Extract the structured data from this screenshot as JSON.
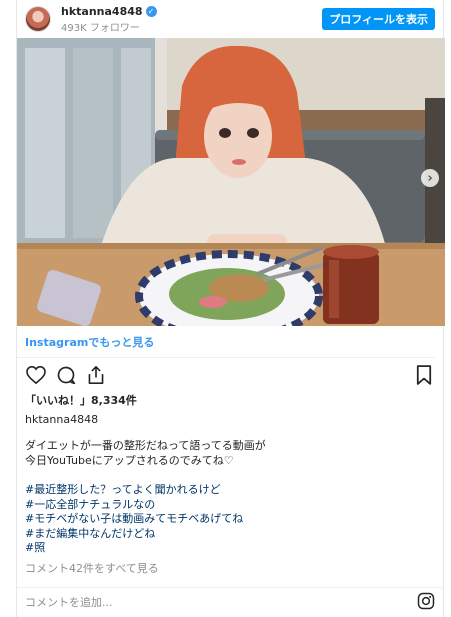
{
  "header": {
    "username": "hktanna4848",
    "followers": "493K フォロワー",
    "profile_button": "プロフィールを表示"
  },
  "icons": {
    "verified": "verified-badge-icon",
    "carousel_next": "chevron-right-icon",
    "like": "heart-icon",
    "comment": "comment-bubble-icon",
    "share": "share-icon",
    "save": "bookmark-icon",
    "brand": "instagram-logo-icon"
  },
  "post": {
    "instagram_link": "Instagramでもっと見る",
    "likes": "「いいね！」8,334件",
    "username": "hktanna4848",
    "caption_lines": [
      "ダイエットが一番の整形だねって語ってる動画が",
      "今日YouTubeにアップされるのでみてね♡"
    ],
    "hashtags": [
      "#最近整形した？ってよく聞かれるけど",
      "#一応全部ナチュラルなの",
      "#モチベがない子は動画みてモチベあげてね",
      "#まだ編集中なんだけどね",
      "#照"
    ],
    "view_comments": "コメント42件をすべて見る",
    "comment_placeholder": "コメントを追加..."
  },
  "colors": {
    "accent": "#0095f6",
    "link": "#3897f0",
    "hashtag": "#003569",
    "muted": "#8e8e8e"
  }
}
